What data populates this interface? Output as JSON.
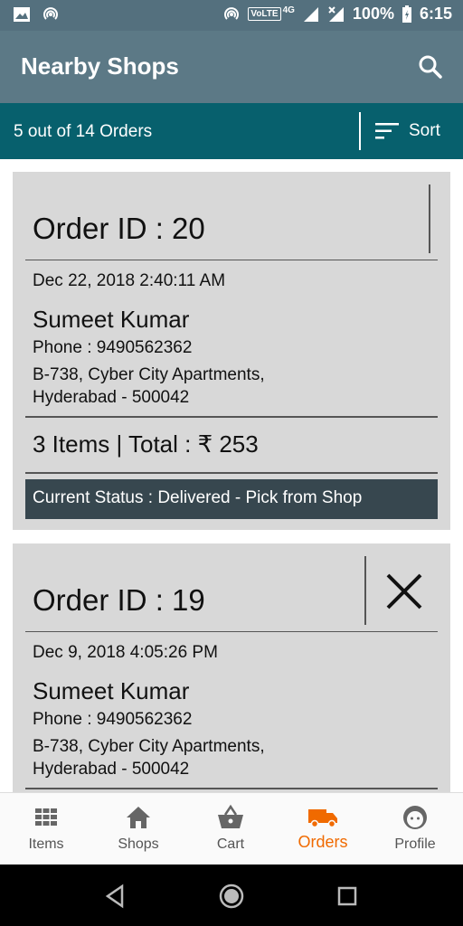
{
  "status_bar": {
    "battery": "100%",
    "time": "6:15",
    "network_badge": "VoLTE",
    "network_type": "4G",
    "icons": [
      "image-icon",
      "hotspot-icon",
      "hotspot-icon",
      "signal-icon",
      "signal-x-icon",
      "battery-icon"
    ]
  },
  "app_bar": {
    "title": "Nearby Shops",
    "search_icon": "search-icon"
  },
  "sub_bar": {
    "order_count": "5 out of 14 Orders",
    "sort_label": "Sort",
    "sort_icon": "sort-icon"
  },
  "orders": [
    {
      "order_id": "Order ID : 20",
      "date": "Dec 22, 2018 2:40:11 AM",
      "customer": "Sumeet Kumar",
      "phone": "Phone : 9490562362",
      "address_line1": "B-738, Cyber City Apartments,",
      "address_line2": "Hyderabad - 500042",
      "items_total": "3 Items  | Total : ₹ 253",
      "status": "Current Status : Delivered - Pick from Shop"
    },
    {
      "order_id": "Order ID : 19",
      "date": "Dec 9, 2018 4:05:26 PM",
      "customer": "Sumeet Kumar",
      "phone": "Phone : 9490562362",
      "address_line1": "B-738, Cyber City Apartments,",
      "address_line2": "Hyderabad - 500042"
    }
  ],
  "bottom_nav": {
    "items": [
      {
        "label": "Items",
        "icon": "grid-icon"
      },
      {
        "label": "Shops",
        "icon": "home-icon"
      },
      {
        "label": "Cart",
        "icon": "basket-icon"
      },
      {
        "label": "Orders",
        "icon": "truck-icon",
        "active": true
      },
      {
        "label": "Profile",
        "icon": "face-icon"
      }
    ]
  },
  "colors": {
    "status_bar": "#54707e",
    "app_bar": "#5c7986",
    "sub_bar": "#07606d",
    "card": "#d8d8d8",
    "status_box": "#37474f",
    "active_nav": "#f06a00"
  }
}
